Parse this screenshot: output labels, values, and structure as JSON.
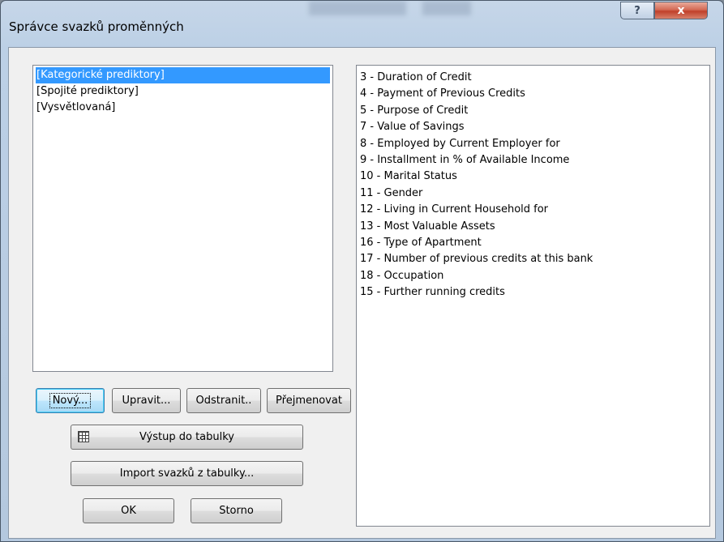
{
  "window": {
    "title": "Správce svazků proměnných",
    "help_label": "?",
    "close_label": "x"
  },
  "bundles": [
    {
      "label": "[Kategorické prediktory]",
      "selected": true
    },
    {
      "label": "[Spojité prediktory]",
      "selected": false
    },
    {
      "label": "[Vysvětlovaná]",
      "selected": false
    }
  ],
  "variables": [
    "3 - Duration of Credit",
    "4 - Payment of Previous Credits",
    "5 - Purpose of Credit",
    "7 - Value of Savings",
    "8 - Employed by Current Employer for",
    "9 - Installment in % of Available Income",
    "10 - Marital Status",
    "11 - Gender",
    "12 - Living in Current Household for",
    "13 - Most Valuable Assets",
    "16 - Type of Apartment",
    "17 - Number of previous credits at this bank",
    "18 - Occupation",
    "15 - Further running credits"
  ],
  "buttons": {
    "new": "Nový...",
    "edit": "Upravit...",
    "remove": "Odstranit..",
    "rename": "Přejmenovat",
    "export": "Výstup do tabulky",
    "import": "Import svazků z tabulky...",
    "ok": "OK",
    "cancel": "Storno"
  },
  "icons": {
    "export": "table-icon",
    "help": "help-icon",
    "close": "close-icon"
  }
}
